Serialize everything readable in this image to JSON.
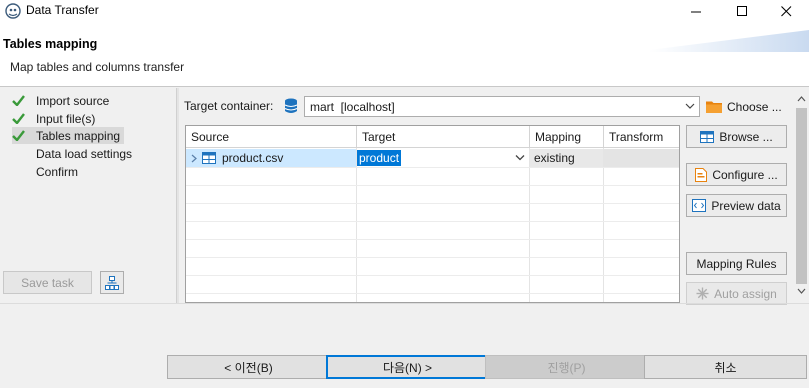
{
  "window": {
    "title": "Data Transfer"
  },
  "header": {
    "title": "Tables mapping",
    "description": "Map tables and columns transfer"
  },
  "steps": [
    {
      "label": "Import source",
      "done": true
    },
    {
      "label": "Input file(s)",
      "done": true
    },
    {
      "label": "Tables mapping",
      "done": true,
      "active": true
    },
    {
      "label": "Data load settings",
      "done": false
    },
    {
      "label": "Confirm",
      "done": false
    }
  ],
  "left_buttons": {
    "save_task": "Save task"
  },
  "target": {
    "label": "Target container:",
    "container": "mart  [localhost]",
    "choose_label": "Choose ..."
  },
  "table": {
    "columns": [
      "Source",
      "Target",
      "Mapping",
      "Transform"
    ],
    "rows": [
      {
        "source": "product.csv",
        "target": "product",
        "mapping": "existing",
        "transform": ""
      }
    ]
  },
  "side_buttons": {
    "browse": "Browse ...",
    "configure": "Configure ...",
    "preview": "Preview data",
    "mapping_rules": "Mapping Rules",
    "auto_assign": "Auto assign"
  },
  "footer": {
    "back": "< 이전(B)",
    "next": "다음(N) >",
    "proceed": "진행(P)",
    "cancel": "취소"
  },
  "colors": {
    "accent": "#0078d7",
    "check_green": "#3a9a3a",
    "selection_bg": "#cce8ff",
    "folder_orange": "#e8830f",
    "db_blue": "#1e73be"
  }
}
